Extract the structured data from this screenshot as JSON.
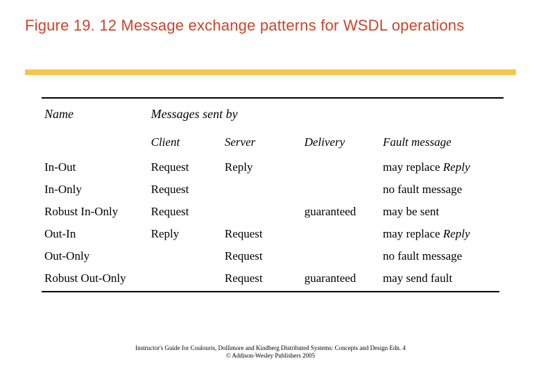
{
  "title": "Figure 19. 12 Message exchange patterns for WSDL operations",
  "headers": {
    "name": "Name",
    "messages_sent_by": "Messages sent by",
    "client": "Client",
    "server": "Server",
    "delivery": "Delivery",
    "fault": "Fault message"
  },
  "rows": [
    {
      "name": "In-Out",
      "client": "Request",
      "server": "Reply",
      "delivery": "",
      "fault_pre": "may replace ",
      "fault_ital": "Reply"
    },
    {
      "name": "In-Only",
      "client": "Request",
      "server": "",
      "delivery": "",
      "fault_pre": "no fault message",
      "fault_ital": ""
    },
    {
      "name": "Robust In-Only",
      "client": "Request",
      "server": "",
      "delivery": "guaranteed",
      "fault_pre": "may be sent",
      "fault_ital": ""
    },
    {
      "name": "Out-In",
      "client": "Reply",
      "server": "Request",
      "delivery": "",
      "fault_pre": "may replace ",
      "fault_ital": "Reply"
    },
    {
      "name": "Out-Only",
      "client": "",
      "server": "Request",
      "delivery": "",
      "fault_pre": "no fault message",
      "fault_ital": ""
    },
    {
      "name": "Robust Out-Only",
      "client": "",
      "server": "Request",
      "delivery": "guaranteed",
      "fault_pre": "may send fault",
      "fault_ital": ""
    }
  ],
  "footer": {
    "line1": "Instructor's Guide for  Coulouris, Dollimore and Kindberg   Distributed Systems: Concepts and Design   Edn. 4",
    "line2": "©  Addison-Wesley Publishers 2005"
  }
}
